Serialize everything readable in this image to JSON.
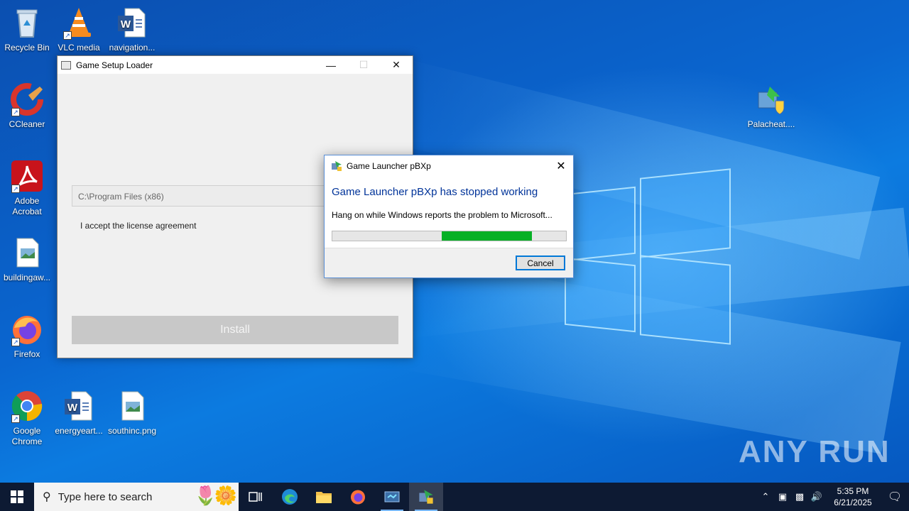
{
  "desktop": {
    "icons": [
      {
        "label": "Recycle Bin"
      },
      {
        "label": "VLC media"
      },
      {
        "label": "navigation..."
      },
      {
        "label": "CCleaner"
      },
      {
        "label": "Adobe Acrobat"
      },
      {
        "label": "buildingaw..."
      },
      {
        "label": "Firefox"
      },
      {
        "label": "Google Chrome"
      },
      {
        "label": "energyeart..."
      },
      {
        "label": "southinc.png"
      },
      {
        "label": "Palacheat...."
      }
    ]
  },
  "setup_window": {
    "title": "Game Setup Loader",
    "install_path": "C:\\Program Files (x86)",
    "license_text": "I accept the license agreement",
    "install_label": "Install"
  },
  "error_dialog": {
    "title": "Game Launcher pBXp",
    "heading": "Game Launcher pBXp has stopped working",
    "message": "Hang on while Windows reports the problem to Microsoft...",
    "cancel_label": "Cancel"
  },
  "watermark": "ANY RUN",
  "taskbar": {
    "search_placeholder": "Type here to search",
    "time": "5:35 PM",
    "date": "6/21/2025"
  },
  "colors": {
    "accent": "#0078d7",
    "progress": "#06b025",
    "dialog_heading": "#003399",
    "taskbar": "#0d1a33"
  }
}
